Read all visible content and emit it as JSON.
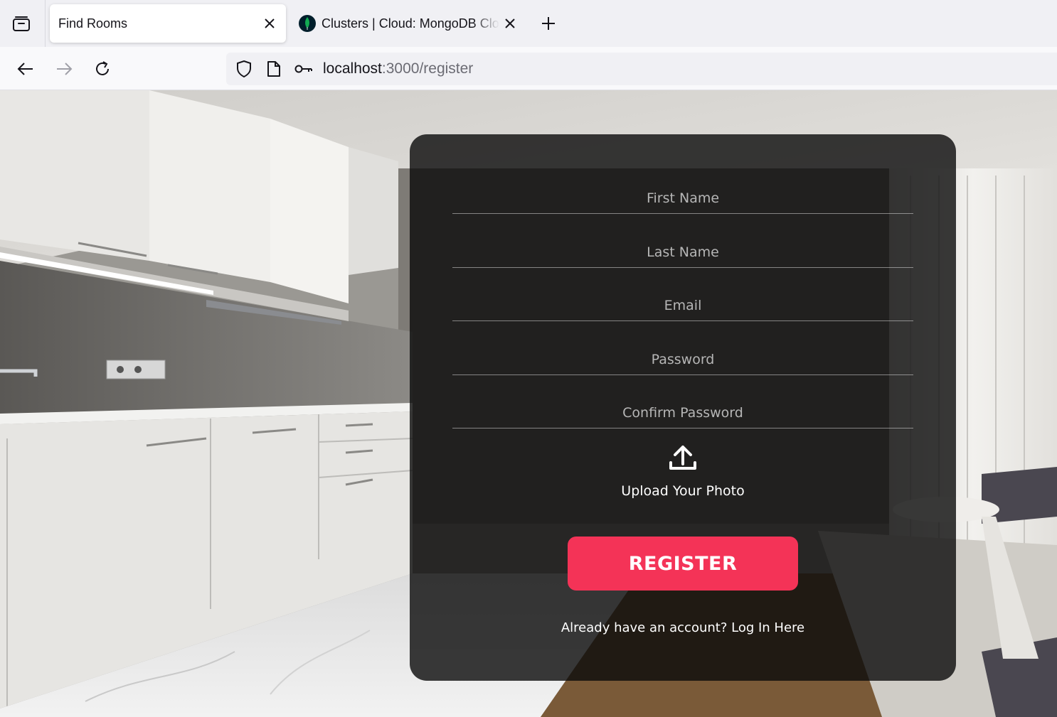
{
  "browser": {
    "tabs": [
      {
        "title": "Find Rooms",
        "active": true
      },
      {
        "title": "Clusters | Cloud: MongoDB Cloud",
        "active": false
      }
    ],
    "url": {
      "host": "localhost",
      "rest": ":3000/register"
    }
  },
  "form": {
    "first_name_placeholder": "First Name",
    "last_name_placeholder": "Last Name",
    "email_placeholder": "Email",
    "password_placeholder": "Password",
    "confirm_password_placeholder": "Confirm Password",
    "upload_label": "Upload Your Photo",
    "register_label": "REGISTER",
    "login_link": "Already have an account? Log In Here"
  },
  "colors": {
    "accent": "#f43357",
    "card": "rgba(10,10,10,0.80)"
  },
  "icons": [
    "tab-list-icon",
    "close-icon",
    "mongodb-leaf-icon",
    "plus-icon",
    "back-arrow-icon",
    "forward-arrow-icon",
    "reload-icon",
    "shield-icon",
    "page-icon",
    "key-icon",
    "upload-icon"
  ]
}
